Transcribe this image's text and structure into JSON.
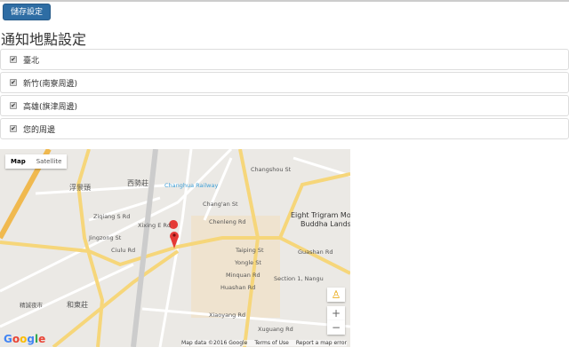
{
  "toolbar": {
    "save_label": "儲存設定"
  },
  "page_title": "通知地點設定",
  "locations": [
    {
      "label": "臺北",
      "checked": true
    },
    {
      "label": "新竹(南寮周邊)",
      "checked": true
    },
    {
      "label": "高雄(旗津周邊)",
      "checked": true
    },
    {
      "label": "您的周邊",
      "checked": true
    }
  ],
  "map": {
    "type_controls": [
      "Map",
      "Satellite"
    ],
    "selected_type": "Map",
    "zoom_in": "+",
    "zoom_out": "−",
    "attribution": "Map data ©2016 Google",
    "terms": "Terms of Use",
    "report": "Report a map error",
    "logo": "Google",
    "labels": [
      "Changhua Railway",
      "西勢莊",
      "浮景頭",
      "和東莊",
      "Chenleng Rd",
      "Taiping St",
      "Yongle St",
      "Minquan Rd",
      "Huashan Rd",
      "Xiaoyang Rd",
      "Changshou St",
      "Eight Trigram Mo",
      "Buddha Landsc",
      "Guashan Rd",
      "Section 1, Nangu",
      "Ziqiang S Rd",
      "Jingzong St",
      "Ciulu Rd",
      "Xixing E Rd",
      "Chang'an St",
      "Xuguang Rd",
      "精誠夜市"
    ]
  }
}
